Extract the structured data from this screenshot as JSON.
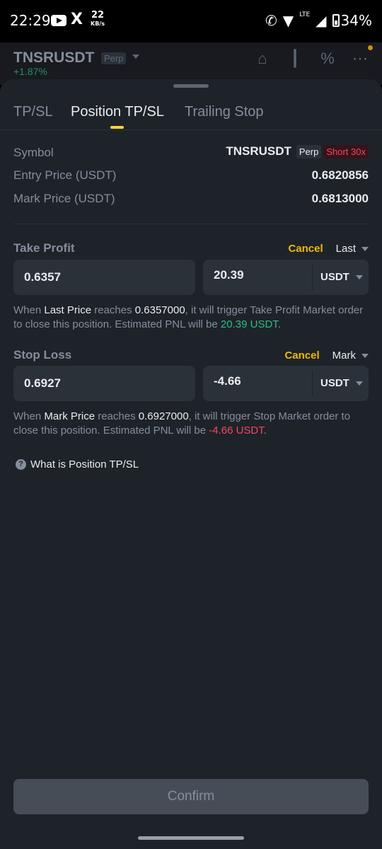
{
  "status": {
    "time": "22:29",
    "x_glyph": "X",
    "speed_value": "22",
    "speed_unit": "KB/s",
    "network": "LTE",
    "battery": "34%"
  },
  "app": {
    "symbol": "TNSRUSDT",
    "type_badge": "Perp",
    "change": "+1.87%"
  },
  "tabs": [
    {
      "label": "TP/SL",
      "active": false
    },
    {
      "label": "Position TP/SL",
      "active": true
    },
    {
      "label": "Trailing Stop",
      "active": false
    }
  ],
  "info": {
    "symbol_label": "Symbol",
    "symbol_value": "TNSRUSDT",
    "perp_badge": "Perp",
    "side_badge": "Short 30x",
    "entry_label": "Entry Price (USDT)",
    "entry_value": "0.6820856",
    "mark_label": "Mark Price (USDT)",
    "mark_value": "0.6813000"
  },
  "take_profit": {
    "title": "Take Profit",
    "cancel": "Cancel",
    "trigger_type": "Last",
    "price": "0.6357",
    "pnl": "20.39",
    "unit": "USDT",
    "desc": {
      "p1": "When ",
      "trigger": "Last Price",
      "p2": " reaches ",
      "price": "0.6357000",
      "p3": ", it will trigger Take Profit Market order to close this position. Estimated PNL will be ",
      "pnl": "20.39 USDT",
      "p4": "."
    }
  },
  "stop_loss": {
    "title": "Stop Loss",
    "cancel": "Cancel",
    "trigger_type": "Mark",
    "price": "0.6927",
    "pnl": "-4.66",
    "unit": "USDT",
    "desc": {
      "p1": "When ",
      "trigger": "Mark Price",
      "p2": " reaches ",
      "price": "0.6927000",
      "p3": ", it will trigger Stop Market order to close this position. Estimated PNL will be ",
      "pnl": "-4.66 USDT",
      "p4": "."
    }
  },
  "help": {
    "label": "What is Position TP/SL"
  },
  "confirm": {
    "label": "Confirm"
  },
  "colors": {
    "accent": "#fcd535",
    "profit": "#2ebd85",
    "loss": "#f6465d",
    "sheet_bg": "#1e2329"
  }
}
